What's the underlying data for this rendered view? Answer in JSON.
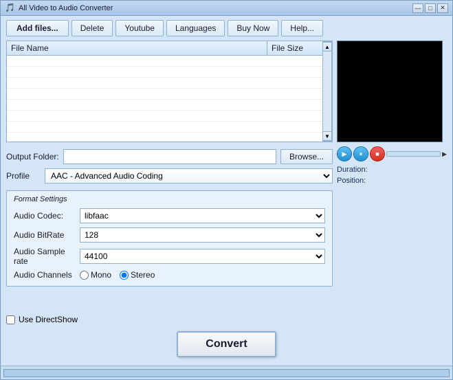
{
  "window": {
    "title": "All Video to Audio Converter",
    "title_icon": "♪"
  },
  "toolbar": {
    "add_files_label": "Add files...",
    "delete_label": "Delete",
    "youtube_label": "Youtube",
    "languages_label": "Languages",
    "buy_now_label": "Buy Now",
    "help_label": "Help..."
  },
  "file_list": {
    "col_name": "File Name",
    "col_size": "File Size"
  },
  "player": {
    "duration_label": "Duration:",
    "position_label": "Position:",
    "duration_value": "",
    "position_value": ""
  },
  "output": {
    "folder_label": "Output Folder:",
    "folder_value": "",
    "browse_label": "Browse..."
  },
  "profile": {
    "label": "Profile",
    "value": "AAC - Advanced Audio Coding"
  },
  "format_settings": {
    "title": "Format Settings",
    "audio_codec_label": "Audio Codec:",
    "audio_codec_value": "libfaac",
    "audio_bitrate_label": "Audio BitRate",
    "audio_bitrate_value": "128",
    "audio_sample_rate_label": "Audio Sample rate",
    "audio_sample_rate_value": "44100",
    "audio_channels_label": "Audio Channels",
    "mono_label": "Mono",
    "stereo_label": "Stereo"
  },
  "use_directshow": {
    "label": "Use DirectShow"
  },
  "convert_btn": {
    "label": "Convert"
  },
  "title_controls": {
    "minimize": "—",
    "maximize": "□",
    "close": "✕"
  }
}
